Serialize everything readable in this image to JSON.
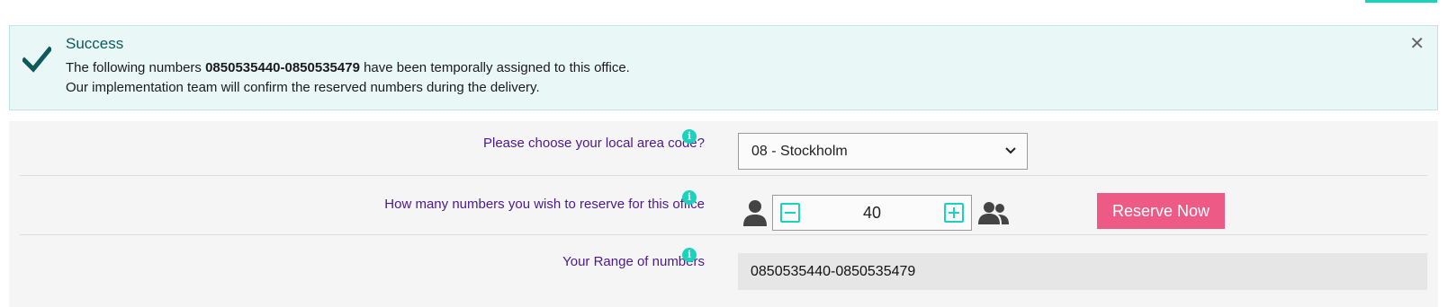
{
  "alert": {
    "title": "Success",
    "line1_prefix": "The following numbers ",
    "line1_numbers": "0850535440-0850535479",
    "line1_suffix": " have been temporally assigned to this office.",
    "line2": "Our implementation team will confirm the reserved numbers during the delivery.",
    "close_symbol": "✕",
    "check_icon": "checkmark-icon",
    "color_title": "#0e5a5a",
    "color_bg": "#eaf7f7"
  },
  "form": {
    "area_code": {
      "label": "Please choose your local area code?",
      "selected": "08 - Stockholm",
      "info_icon": "info-icon"
    },
    "reserve_count": {
      "label": "How many numbers you wish to reserve for this office",
      "value": "40",
      "info_icon": "info-icon",
      "single_user_icon": "person-icon",
      "group_icon": "group-icon"
    },
    "reserve_button": {
      "label": "Reserve Now",
      "color": "#ee5a86"
    },
    "range": {
      "label": "Your Range of numbers",
      "value": "0850535440-0850535479",
      "info_icon": "info-icon"
    }
  },
  "colors": {
    "label_purple": "#4b1a8c",
    "accent_teal": "#19d3bd",
    "panel_bg": "#f5f5f5"
  }
}
